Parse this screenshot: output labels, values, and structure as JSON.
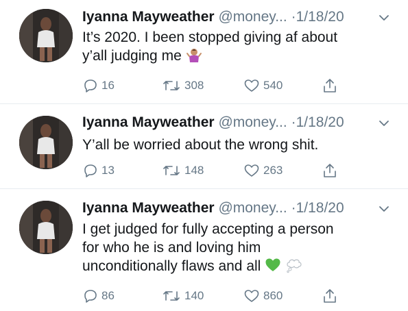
{
  "tweets": [
    {
      "name": "Iyanna Mayweather",
      "handle": "@money...",
      "separator": "·",
      "date": "1/18/20",
      "lines": [
        "It’s 2020. I been stopped giving af about",
        "y’all judging me"
      ],
      "emoji": [
        "person-shrugging-emoji"
      ],
      "replies": "16",
      "retweets": "308",
      "likes": "540"
    },
    {
      "name": "Iyanna Mayweather",
      "handle": "@money...",
      "separator": "·",
      "date": "1/18/20",
      "lines": [
        "Y’all be worried about the wrong shit."
      ],
      "emoji": [],
      "replies": "13",
      "retweets": "148",
      "likes": "263"
    },
    {
      "name": "Iyanna Mayweather",
      "handle": "@money...",
      "separator": "·",
      "date": "1/18/20",
      "lines": [
        "I get judged for fully accepting a person",
        "for who he is and loving him",
        "unconditionally flaws and all"
      ],
      "emoji": [
        "green-heart-emoji",
        "thought-balloon-emoji"
      ],
      "replies": "86",
      "retweets": "140",
      "likes": "860"
    }
  ],
  "colors": {
    "text": "#14171a",
    "secondary": "#657786",
    "divider": "#e6ecf0",
    "green_heart": "#54b948"
  }
}
